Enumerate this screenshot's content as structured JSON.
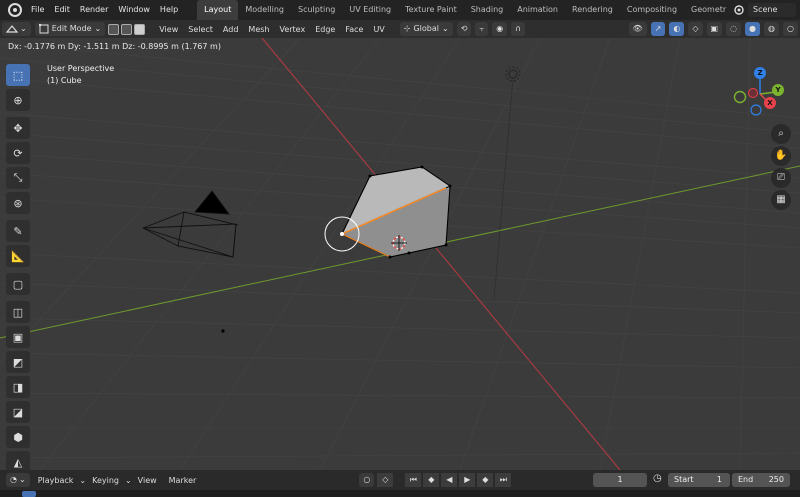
{
  "menu": {
    "items": [
      "File",
      "Edit",
      "Render",
      "Window",
      "Help"
    ],
    "workspaces": [
      "Layout",
      "Modelling",
      "Sculpting",
      "UV Editing",
      "Texture Paint",
      "Shading",
      "Animation",
      "Rendering",
      "Compositing",
      "Geometr"
    ],
    "active_workspace": "Layout",
    "scene": "Scene"
  },
  "header": {
    "mode": "Edit Mode",
    "menus": [
      "View",
      "Select",
      "Add",
      "Mesh",
      "Vertex",
      "Edge",
      "Face",
      "UV"
    ],
    "transform_orientation": "Global"
  },
  "viewport": {
    "measurement": "Dx: -0.1776 m   Dy: -1.511 m   Dz: -0.8995 m (1.767 m)",
    "view_name": "User Perspective",
    "object_name": "(1) Cube",
    "gizmo": {
      "x": "X",
      "y": "Y",
      "z": "Z"
    }
  },
  "timeline": {
    "menus": [
      "Playback",
      "Keying",
      "View",
      "Marker"
    ],
    "current_frame": "1",
    "start_label": "Start",
    "start_value": "1",
    "end_label": "End",
    "end_value": "250"
  },
  "colors": {
    "accent": "#4772b3",
    "x_axis": "#e8424b",
    "y_axis": "#7bb32e",
    "z_axis": "#2f80e8"
  }
}
